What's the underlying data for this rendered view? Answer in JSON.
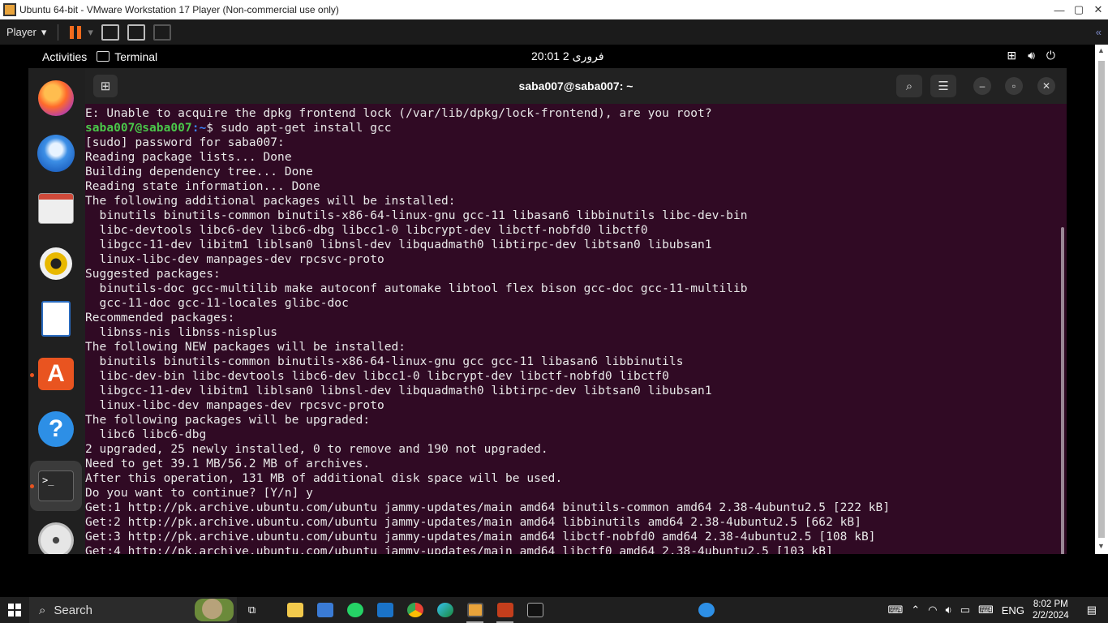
{
  "vmware": {
    "title": "Ubuntu 64-bit - VMware Workstation 17 Player (Non-commercial use only)",
    "player_menu": "Player",
    "collapse_glyph": "«"
  },
  "gnome": {
    "activities": "Activities",
    "app_name": "Terminal",
    "clock": "20:01  2 فروری"
  },
  "dock": {
    "items": [
      "firefox",
      "thunderbird",
      "files",
      "rhythmbox",
      "libreoffice-writer",
      "ubuntu-software",
      "help",
      "terminal",
      "disc"
    ],
    "terminal_glyph": ">_",
    "store_glyph": "A",
    "help_glyph": "?"
  },
  "terminal": {
    "title": "saba007@saba007: ~",
    "prompt_user": "saba007@saba007",
    "prompt_path": ":~",
    "prompt_cmd": "$ sudo apt-get install gcc",
    "lines_before": [
      "E: Unable to acquire the dpkg frontend lock (/var/lib/dpkg/lock-frontend), are you root?"
    ],
    "lines_after": [
      "[sudo] password for saba007:",
      "Reading package lists... Done",
      "Building dependency tree... Done",
      "Reading state information... Done",
      "The following additional packages will be installed:",
      "  binutils binutils-common binutils-x86-64-linux-gnu gcc-11 libasan6 libbinutils libc-dev-bin",
      "  libc-devtools libc6-dev libc6-dbg libcc1-0 libcrypt-dev libctf-nobfd0 libctf0",
      "  libgcc-11-dev libitm1 liblsan0 libnsl-dev libquadmath0 libtirpc-dev libtsan0 libubsan1",
      "  linux-libc-dev manpages-dev rpcsvc-proto",
      "Suggested packages:",
      "  binutils-doc gcc-multilib make autoconf automake libtool flex bison gcc-doc gcc-11-multilib",
      "  gcc-11-doc gcc-11-locales glibc-doc",
      "Recommended packages:",
      "  libnss-nis libnss-nisplus",
      "The following NEW packages will be installed:",
      "  binutils binutils-common binutils-x86-64-linux-gnu gcc gcc-11 libasan6 libbinutils",
      "  libc-dev-bin libc-devtools libc6-dev libcc1-0 libcrypt-dev libctf-nobfd0 libctf0",
      "  libgcc-11-dev libitm1 liblsan0 libnsl-dev libquadmath0 libtirpc-dev libtsan0 libubsan1",
      "  linux-libc-dev manpages-dev rpcsvc-proto",
      "The following packages will be upgraded:",
      "  libc6 libc6-dbg",
      "2 upgraded, 25 newly installed, 0 to remove and 190 not upgraded.",
      "Need to get 39.1 MB/56.2 MB of archives.",
      "After this operation, 131 MB of additional disk space will be used.",
      "Do you want to continue? [Y/n] y",
      "Get:1 http://pk.archive.ubuntu.com/ubuntu jammy-updates/main amd64 binutils-common amd64 2.38-4ubuntu2.5 [222 kB]",
      "Get:2 http://pk.archive.ubuntu.com/ubuntu jammy-updates/main amd64 libbinutils amd64 2.38-4ubuntu2.5 [662 kB]",
      "Get:3 http://pk.archive.ubuntu.com/ubuntu jammy-updates/main amd64 libctf-nobfd0 amd64 2.38-4ubuntu2.5 [108 kB]",
      "Get:4 http://pk.archive.ubuntu.com/ubuntu jammy-updates/main amd64 libctf0 amd64 2.38-4ubuntu2.5 [103 kB]"
    ]
  },
  "taskbar": {
    "search_placeholder": "Search",
    "language": "ENG",
    "time": "8:02 PM",
    "date": "2/2/2024"
  },
  "colors": {
    "terminal_bg": "#300a24",
    "prompt_user": "#4ac74a",
    "prompt_path": "#3b82f6",
    "accent": "#e95420"
  }
}
